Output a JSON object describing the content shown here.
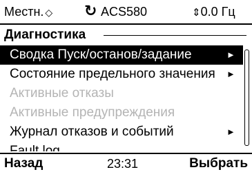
{
  "status": {
    "location": "Местн.",
    "location_icon": "◇",
    "direction_icon": "↻",
    "drive": "ACS580",
    "reference_icon": "⇕",
    "reference": "0.0 Гц"
  },
  "title": "Диагностика",
  "menu": {
    "items": [
      {
        "label": "Сводка Пуск/останов/задание",
        "arrow": "►"
      },
      {
        "label": "Состояние предельного значения",
        "arrow": "►"
      },
      {
        "label": "Активные отказы",
        "arrow": ""
      },
      {
        "label": "Активные предупреждения",
        "arrow": ""
      },
      {
        "label": "Журнал отказов и событий",
        "arrow": "►"
      },
      {
        "label": "Fault log"
      }
    ]
  },
  "footer": {
    "left": "Назад",
    "time": "23:31",
    "right": "Выбрать"
  },
  "colors": {
    "selected_bg": "#000000",
    "disabled_text": "#b4b4b4"
  }
}
